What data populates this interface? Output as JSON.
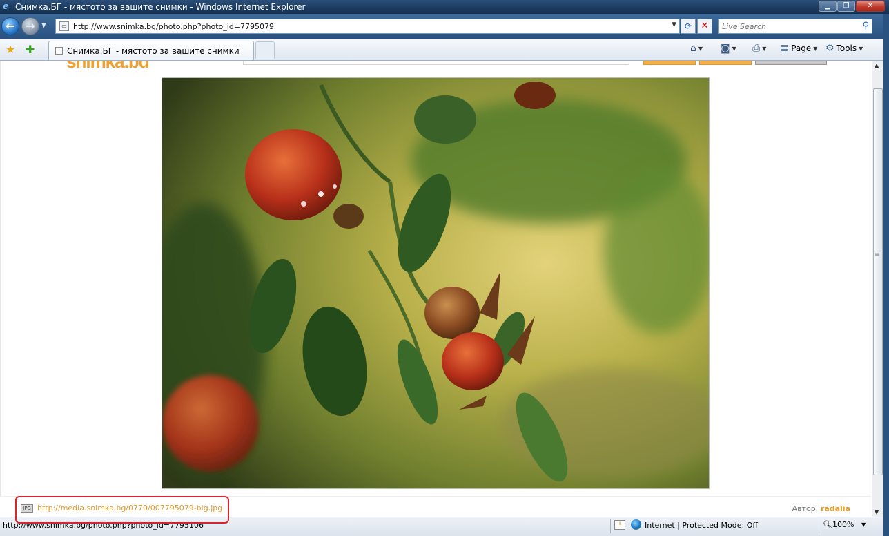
{
  "window": {
    "title": "Снимка.БГ - мястото за вашите снимки - Windows Internet Explorer",
    "minimize": "▁",
    "restore": "❐",
    "close": "✕"
  },
  "nav": {
    "back": "←",
    "forward": "→",
    "url": "http://www.snimka.bg/photo.php?photo_id=7795079",
    "refresh": "⟳",
    "stop": "✕",
    "search_placeholder": "Live Search"
  },
  "tabs": {
    "active_label": "Снимка.БГ - мястото за вашите снимки"
  },
  "commandbar": {
    "page_label": "Page",
    "tools_label": "Tools"
  },
  "site": {
    "logo": "snimka.bg"
  },
  "photo_footer": {
    "image_link": "http://media.snimka.bg/0770/007795079-big.jpg",
    "author_label": "Автор:",
    "author_name": "radalia"
  },
  "statusbar": {
    "text": "http://www.snimka.bg/photo.php?photo_id=7795106",
    "zone": "Internet | Protected Mode: Off",
    "zoom": "100%"
  },
  "colors": {
    "accent": "#e39a27",
    "highlight_box": "#d9232d",
    "titlebar": "#1b3a5e"
  }
}
